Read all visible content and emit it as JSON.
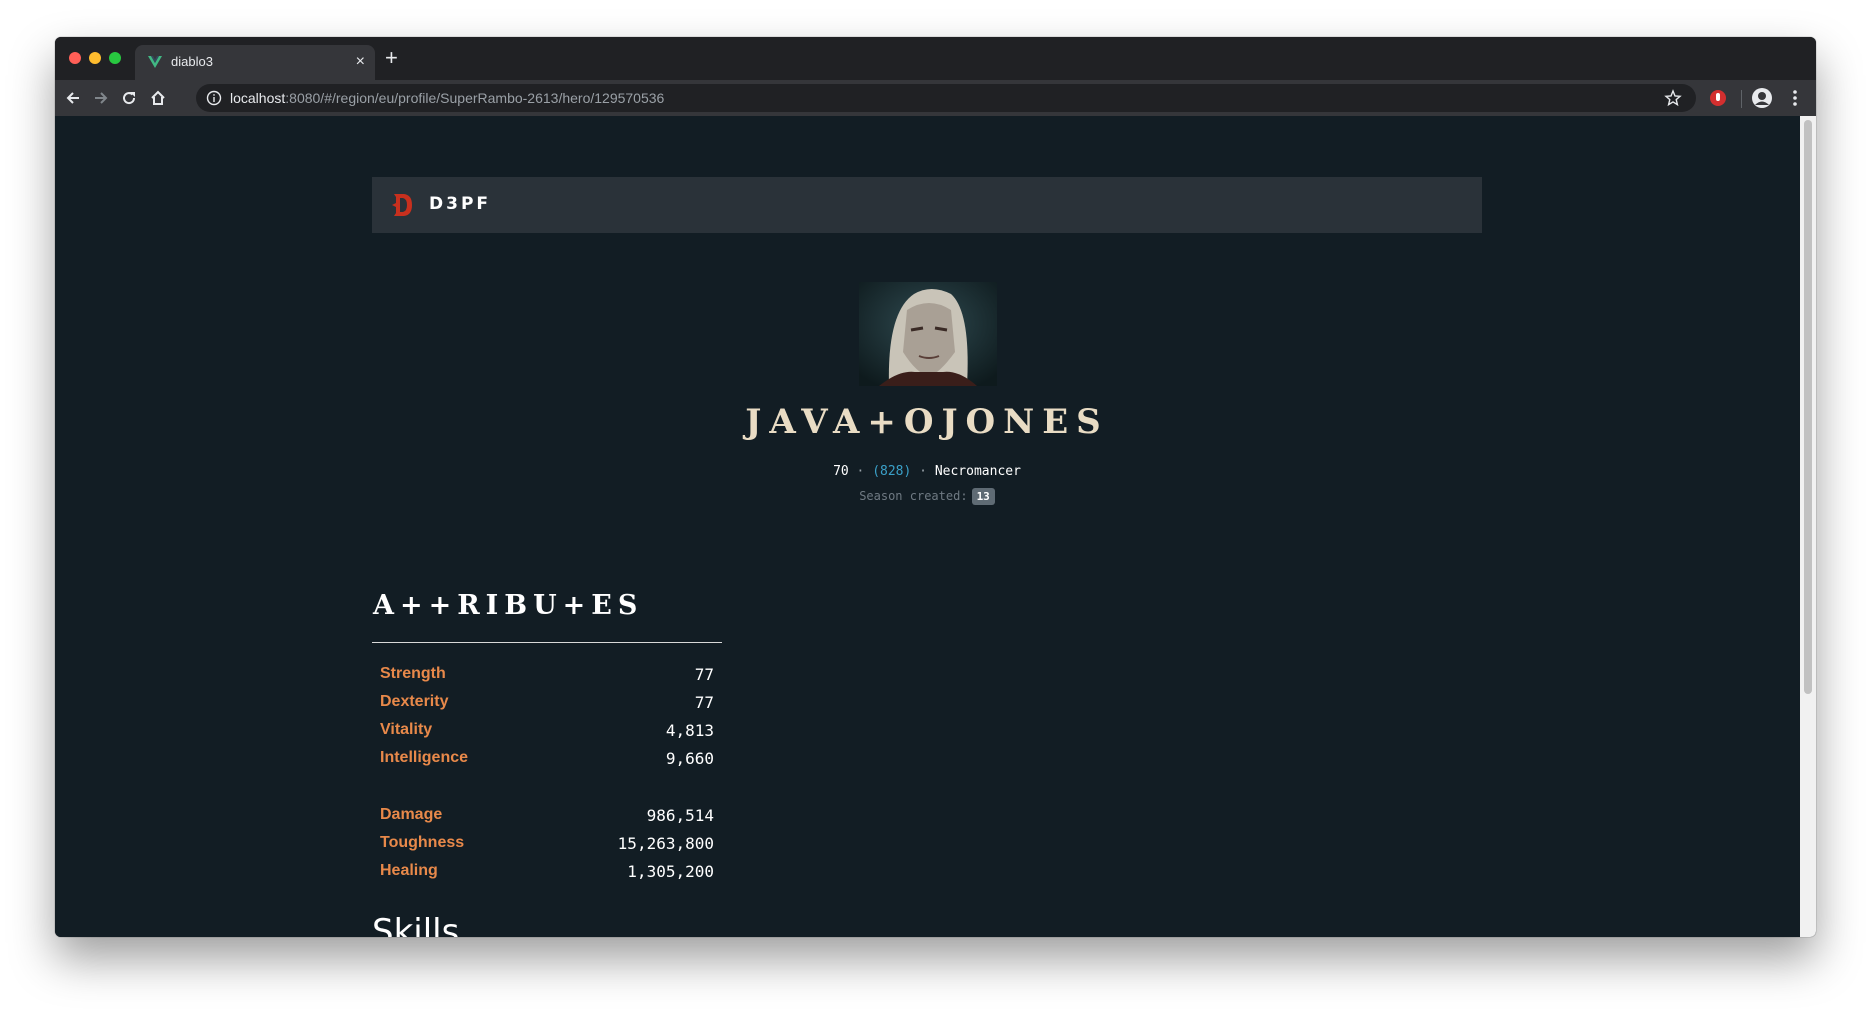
{
  "browser": {
    "tab_title": "diablo3",
    "tab_close": "×",
    "new_tab": "+",
    "url_host": "localhost",
    "url_path": ":8080/#/region/eu/profile/SuperRambo-2613/hero/129570536",
    "colors": {
      "chrome_dark": "#202124",
      "chrome_toolbar": "#35363a",
      "favicon": "#41b883"
    }
  },
  "nav": {
    "brand": "D3PF",
    "logo_icon": "diablo-d-logo-icon",
    "colors": {
      "background": "#2a3239",
      "logo_red": "#c8301e"
    }
  },
  "hero": {
    "name": "JAVA+OJONES",
    "level": "70",
    "separator": "·",
    "paragon": "(828)",
    "class": "Necromancer",
    "season_label": "Season created:",
    "season_value": "13",
    "colors": {
      "name": "#e9dcc4",
      "paragon": "#3aa0c8"
    }
  },
  "attributes": {
    "heading": "A++RIBU+ES",
    "primary": [
      {
        "label": "Strength",
        "value": "77"
      },
      {
        "label": "Dexterity",
        "value": "77"
      },
      {
        "label": "Vitality",
        "value": "4,813"
      },
      {
        "label": "Intelligence",
        "value": "9,660"
      }
    ],
    "secondary": [
      {
        "label": "Damage",
        "value": "986,514"
      },
      {
        "label": "Toughness",
        "value": "15,263,800"
      },
      {
        "label": "Healing",
        "value": "1,305,200"
      }
    ],
    "colors": {
      "label": "#e8894a",
      "value": "#ffffff"
    }
  },
  "skills": {
    "heading": "Skills"
  },
  "page": {
    "background": "#121d24"
  }
}
